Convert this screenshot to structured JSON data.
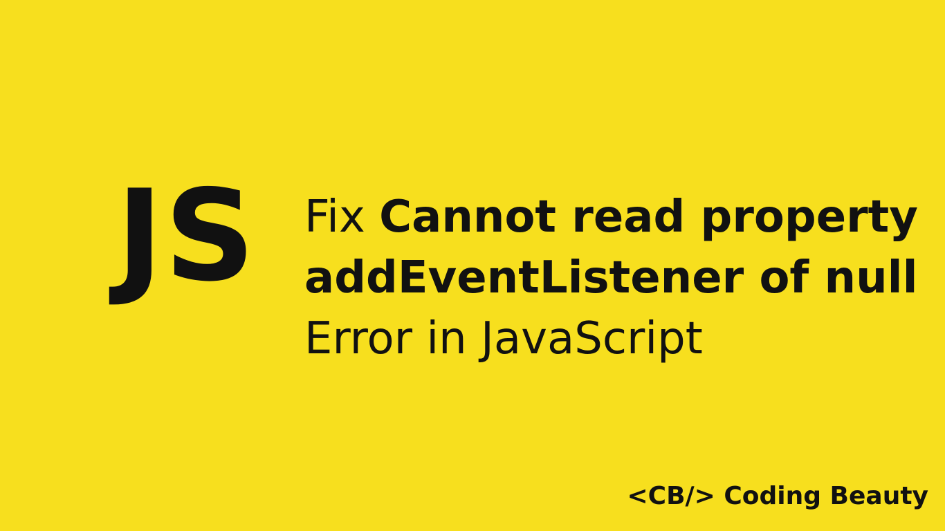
{
  "colors": {
    "background": "#f7df1e",
    "text": "#111111"
  },
  "logo": {
    "text": "JS"
  },
  "headline": {
    "line1_prefix": "Fix",
    "line1_bold": "Cannot read property",
    "line2_bold": "addEventListener of null",
    "line3": "Error in JavaScript"
  },
  "brand": {
    "text": "<CB/> Coding Beauty"
  }
}
